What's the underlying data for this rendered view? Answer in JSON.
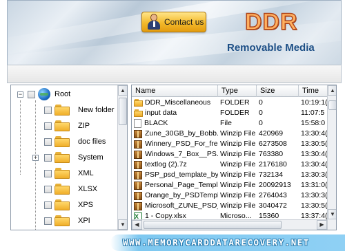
{
  "header": {
    "contact_label": "Contact us",
    "brand": "DDR",
    "product": "Removable Media"
  },
  "tree": {
    "root_label": "Root",
    "items": [
      {
        "label": "New folder",
        "expandable": false
      },
      {
        "label": "ZIP",
        "expandable": false
      },
      {
        "label": "doc files",
        "expandable": false
      },
      {
        "label": "System",
        "expandable": true
      },
      {
        "label": "XML",
        "expandable": false
      },
      {
        "label": "XLSX",
        "expandable": false
      },
      {
        "label": "XPS",
        "expandable": false
      },
      {
        "label": "XPI",
        "expandable": false
      }
    ]
  },
  "list": {
    "columns": [
      "Name",
      "Type",
      "Size",
      "Time"
    ],
    "rows": [
      {
        "icon": "folder",
        "name": "DDR_Miscellaneous",
        "type": "FOLDER",
        "size": "0",
        "time": "10:19:1("
      },
      {
        "icon": "folder",
        "name": "input data",
        "type": "FOLDER",
        "size": "0",
        "time": "11:07:5"
      },
      {
        "icon": "file",
        "name": "BLACK",
        "type": "File",
        "size": "0",
        "time": "15:58:0"
      },
      {
        "icon": "zip",
        "name": "Zune_30GB_by_Bobb...",
        "type": "Winzip File",
        "size": "420969",
        "time": "13:30:4("
      },
      {
        "icon": "zip",
        "name": "Winnery_PSD_For_fre...",
        "type": "Winzip File",
        "size": "6273508",
        "time": "13:30:5("
      },
      {
        "icon": "zip",
        "name": "Windows_7_Box__PS...",
        "type": "Winzip File",
        "size": "763380",
        "time": "13:30:4("
      },
      {
        "icon": "zip",
        "name": "textlog (2).7z",
        "type": "Winzip File",
        "size": "2176180",
        "time": "13:30:4("
      },
      {
        "icon": "zip",
        "name": "PSP_psd_template_by...",
        "type": "Winzip File",
        "size": "732134",
        "time": "13:30:3("
      },
      {
        "icon": "zip",
        "name": "Personal_Page_Templ...",
        "type": "Winzip File",
        "size": "20092913",
        "time": "13:31:0("
      },
      {
        "icon": "zip",
        "name": "Orange_by_PSDTempl...",
        "type": "Winzip File",
        "size": "2764043",
        "time": "13:30:3("
      },
      {
        "icon": "zip",
        "name": "Microsoft_ZUNE_PSD_...",
        "type": "Winzip File",
        "size": "3040472",
        "time": "13:30:5("
      },
      {
        "icon": "xlsx",
        "name": "1 - Copy.xlsx",
        "type": "Microso...",
        "size": "15360",
        "time": "13:37:4("
      }
    ]
  },
  "footer": {
    "url": "WWW.MEMORYCARDDATARECOVERY.NET"
  },
  "colors": {
    "brand_orange": "#ffb060",
    "product_blue": "#1d4f86",
    "footer_cyan": "#7ec8f0"
  }
}
